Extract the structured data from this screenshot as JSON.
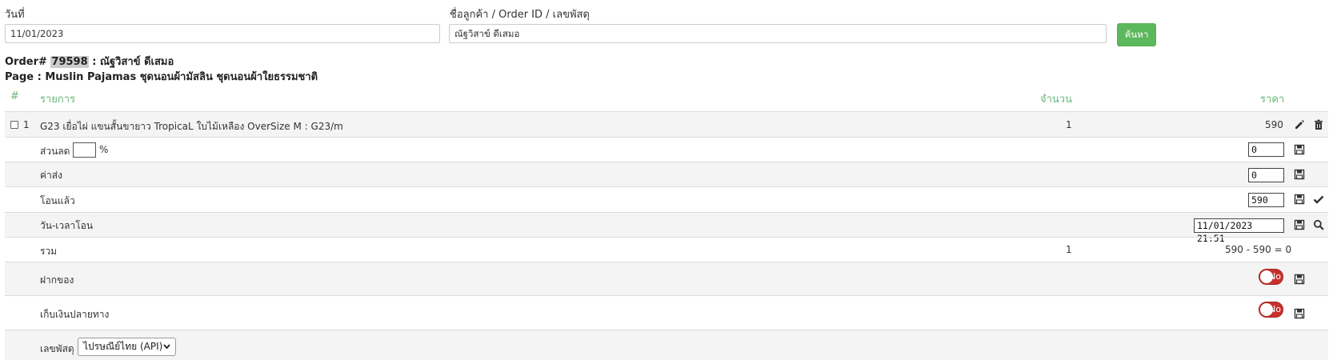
{
  "search": {
    "date_label": "วันที่",
    "date_value": "11/01/2023",
    "query_label": "ชื่อลูกค้า / Order ID / เลขพัสดุ",
    "query_value": "ณัฐวิสาข์ ดีเสมอ",
    "search_button": "ค้นหา"
  },
  "order": {
    "prefix": "Order#",
    "id": "79598",
    "customer": ": ณัฐวิสาข์ ดีเสมอ",
    "page_line": "Page : Muslin Pajamas ชุดนอนผ้ามัสลิน ชุดนอนผ้าใยธรรมชาติ"
  },
  "table": {
    "headers": {
      "num": "#",
      "item": "รายการ",
      "qty": "จำนวน",
      "price": "ราคา"
    },
    "items": [
      {
        "index": "1",
        "name": "G23 เยื่อไผ่ แขนสั้นขายาว TropicaL ใบไม้เหลือง OverSize M : G23/m",
        "qty": "1",
        "price": "590"
      }
    ]
  },
  "rows": {
    "discount_label": "ส่วนลด",
    "discount_percent": "",
    "discount_unit": "%",
    "discount_value": "0",
    "shipping_label": "ค่าส่ง",
    "shipping_value": "0",
    "paid_label": "โอนแล้ว",
    "paid_value": "590",
    "transfer_time_label": "วัน-เวลาโอน",
    "transfer_time_value": "11/01/2023 21:51",
    "total_label": "รวม",
    "total_qty": "1",
    "total_calc": "590 - 590 = 0",
    "deposit_label": "ฝากของ",
    "deposit_toggle": "No",
    "cod_label": "เก็บเงินปลายทาง",
    "cod_toggle": "No",
    "tracking_label": "เลขพัสดุ",
    "carrier_selected": "ไปรษณีย์ไทย (API)"
  },
  "colors": {
    "accent_green": "#5cb85c",
    "header_green": "#6ab87a",
    "toggle_red": "#c9302c"
  }
}
